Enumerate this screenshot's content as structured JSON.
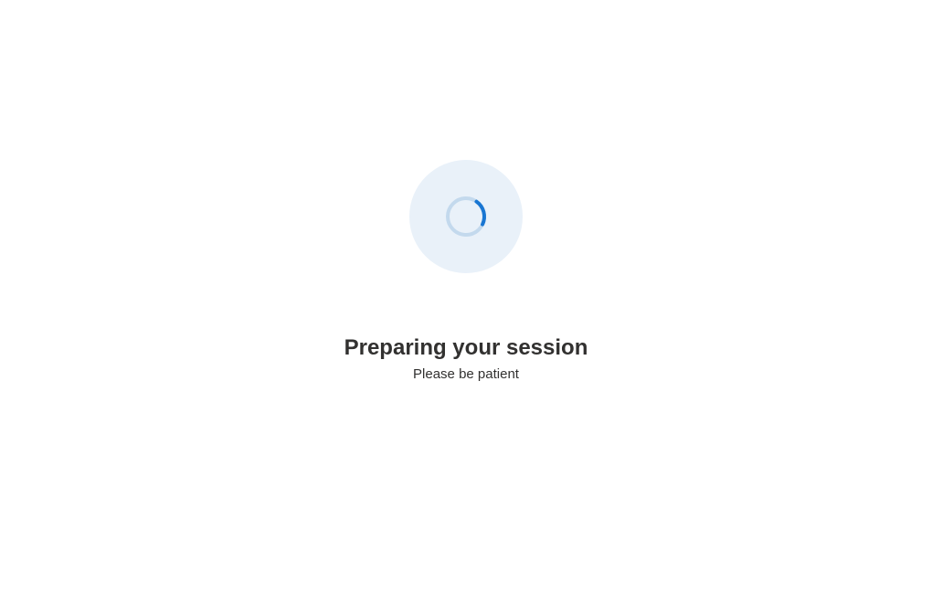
{
  "loading": {
    "heading": "Preparing your session",
    "subtext": "Please be patient"
  }
}
